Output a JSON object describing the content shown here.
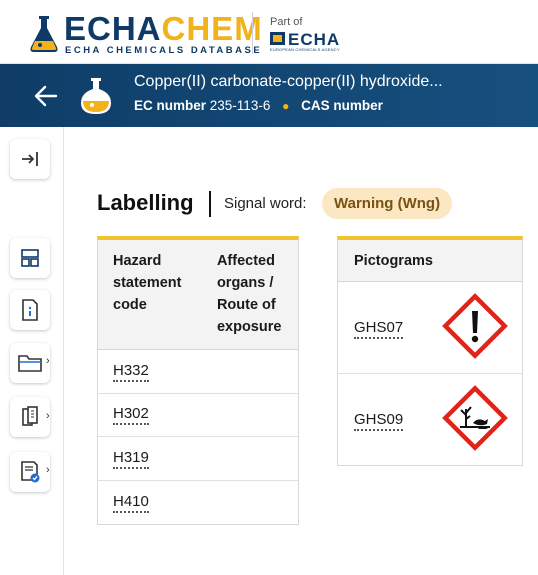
{
  "brand": {
    "name_part1": "ECHA",
    "name_part2": "CHEM",
    "subtitle": "ECHA CHEMICALS DATABASE",
    "part_of": "Part of",
    "agency": "ECHA",
    "agency_sub": "EUROPEAN CHEMICALS AGENCY",
    "colors": {
      "navy": "#0f3a68",
      "yellow": "#f2b21b"
    }
  },
  "substance": {
    "title": "Copper(II) carbonate-copper(II) hydroxide...",
    "ec_label": "EC number",
    "ec_value": "235-113-6",
    "cas_label": "CAS number",
    "header_color": "#11446f"
  },
  "sidebar": {
    "items": [
      {
        "icon": "expand-sidebar-icon",
        "has_chevron": false
      },
      {
        "icon": "layout-icon",
        "has_chevron": false
      },
      {
        "icon": "info-document-icon",
        "has_chevron": false
      },
      {
        "icon": "folder-icon",
        "has_chevron": true
      },
      {
        "icon": "documents-icon",
        "has_chevron": true
      },
      {
        "icon": "certificate-icon",
        "has_chevron": true
      }
    ]
  },
  "labelling": {
    "title": "Labelling",
    "signal_word_label": "Signal word:",
    "signal_word_value": "Warning (Wng)",
    "hazard_table": {
      "headers": [
        "Hazard statement code",
        "Affected organs / Route of exposure"
      ],
      "header_lines": [
        [
          "Hazard",
          "statement",
          "code"
        ],
        [
          "Affected",
          "organs /",
          "Route of",
          "exposure"
        ]
      ],
      "rows": [
        "H332",
        "H302",
        "H319",
        "H410"
      ]
    },
    "pictogram_table": {
      "header": "Pictograms",
      "rows": [
        {
          "code": "GHS07",
          "icon": "exclamation-mark-pictogram"
        },
        {
          "code": "GHS09",
          "icon": "environment-pictogram"
        }
      ]
    }
  }
}
